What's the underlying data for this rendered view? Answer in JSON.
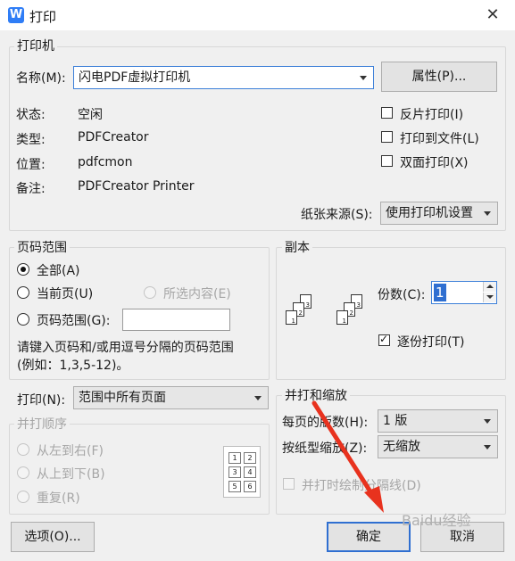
{
  "window": {
    "title": "打印",
    "app_icon_letter": "W",
    "close_glyph": "✕"
  },
  "printer": {
    "legend": "打印机",
    "name_label": "名称(M):",
    "name_value": "闪电PDF虚拟打印机",
    "properties_button": "属性(P)...",
    "status_label": "状态:",
    "status_value": "空闲",
    "type_label": "类型:",
    "type_value": "PDFCreator",
    "location_label": "位置:",
    "location_value": "pdfcmon",
    "comment_label": "备注:",
    "comment_value": "PDFCreator Printer",
    "reverse_label": "反片打印(I)",
    "print_to_file_label": "打印到文件(L)",
    "duplex_label": "双面打印(X)",
    "paper_source_label": "纸张来源(S):",
    "paper_source_value": "使用打印机设置"
  },
  "page_range": {
    "legend": "页码范围",
    "all_label": "全部(A)",
    "current_label": "当前页(U)",
    "selection_label": "所选内容(E)",
    "pages_label": "页码范围(G):",
    "pages_value": "",
    "hint_line1": "请键入页码和/或用逗号分隔的页码范围",
    "hint_line2": "(例如：1,3,5-12)。"
  },
  "copies": {
    "legend": "副本",
    "count_label": "份数(C):",
    "count_value": "1",
    "collate_label": "逐份打印(T)",
    "icon_pages": [
      "1",
      "2",
      "3"
    ]
  },
  "print_what": {
    "label": "打印(N):",
    "value": "范围中所有页面"
  },
  "order": {
    "legend": "并打顺序",
    "left_to_right": "从左到右(F)",
    "top_to_bottom": "从上到下(B)",
    "repeat": "重复(R)",
    "preview_numbers": [
      "1",
      "2",
      "3",
      "4",
      "5",
      "6"
    ]
  },
  "zoom": {
    "legend": "并打和缩放",
    "pages_per_sheet_label": "每页的版数(H):",
    "pages_per_sheet_value": "1 版",
    "scale_label": "按纸型缩放(Z):",
    "scale_value": "无缩放",
    "divider_label": "并打时绘制分隔线(D)"
  },
  "buttons": {
    "options": "选项(O)...",
    "ok": "确定",
    "cancel": "取消"
  },
  "watermark": "Baidu经验",
  "colors": {
    "accent": "#2f6fd1",
    "arrow": "#e8321e"
  }
}
